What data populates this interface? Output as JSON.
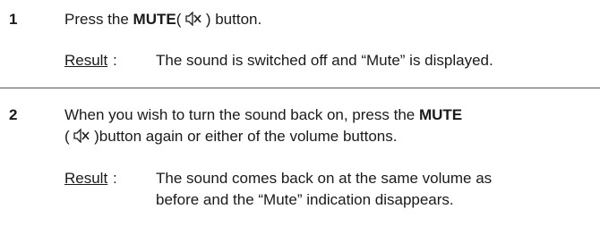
{
  "steps": [
    {
      "number": "1",
      "instruction": {
        "pre": "Press the ",
        "button": "MUTE",
        "post_icon": " ) button."
      },
      "result_label": "Result",
      "result_colon": ":",
      "result_lines": [
        "The sound is switched off and “Mute” is displayed."
      ]
    },
    {
      "number": "2",
      "instruction": {
        "line1_pre": "When you wish to turn the sound back on, press the ",
        "button": "MUTE",
        "line2_post_icon": " )button again or either of the volume buttons."
      },
      "result_label": "Result",
      "result_colon": ":",
      "result_lines": [
        "The sound comes back on at the same volume as",
        "before and the “Mute” indication disappears."
      ]
    }
  ],
  "icons": {
    "mute": "mute-speaker-icon"
  }
}
